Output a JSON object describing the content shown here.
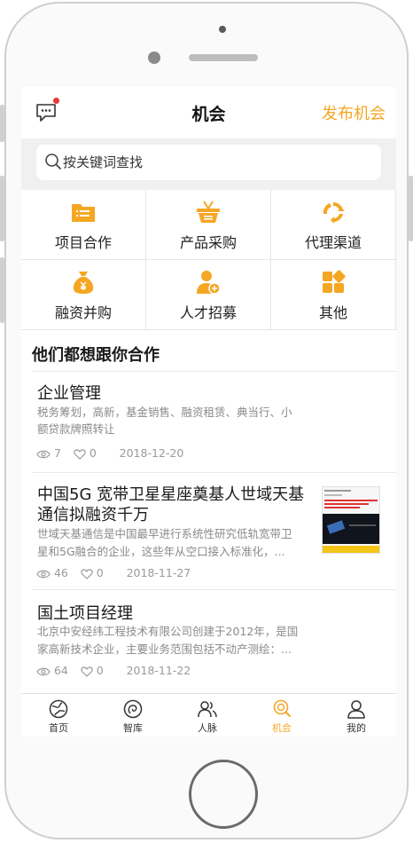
{
  "colors": {
    "accent": "#f5a623",
    "badge": "#e53935",
    "text": "#222222",
    "muted": "#8a8a8a"
  },
  "header": {
    "title": "机会",
    "publish_label": "发布机会",
    "message_icon": "chat-bubble-icon"
  },
  "search": {
    "placeholder": "按关键词查找"
  },
  "categories": [
    {
      "label": "项目合作",
      "icon": "folder-list-icon"
    },
    {
      "label": "产品采购",
      "icon": "basket-icon"
    },
    {
      "label": "代理渠道",
      "icon": "cycle-arrows-icon"
    },
    {
      "label": "融资并购",
      "icon": "money-bag-icon"
    },
    {
      "label": "人才招募",
      "icon": "add-person-icon"
    },
    {
      "label": "其他",
      "icon": "grid-icon"
    }
  ],
  "section": {
    "title": "他们都想跟你合作"
  },
  "opportunities": [
    {
      "title": "企业管理",
      "desc_lines": [
        "税务筹划，高新，基金销售、融资租赁、典当行、小",
        "额贷款牌照转让"
      ],
      "views": "7",
      "likes": "0",
      "date": "2018-12-20"
    },
    {
      "title_lines": [
        "中国5G 宽带卫星星座奠基人世域天基",
        "通信拟融资千万"
      ],
      "desc_lines": [
        "世域天基通信是中国最早进行系统性研究低轨宽带卫",
        "星和5G融合的企业，这些年从空口接入标准化，..."
      ],
      "views": "46",
      "likes": "0",
      "date": "2018-11-27",
      "has_thumbnail": true
    },
    {
      "title": "国土项目经理",
      "desc_lines": [
        "北京中安经纬工程技术有限公司创建于2012年，是国",
        "家高新技术企业，主要业务范围包括不动产测绘：..."
      ],
      "views": "64",
      "likes": "0",
      "date": "2018-11-22"
    }
  ],
  "tabs": [
    {
      "label": "首页",
      "icon": "home-globe-icon",
      "active": false
    },
    {
      "label": "智库",
      "icon": "think-tank-icon",
      "active": false
    },
    {
      "label": "人脉",
      "icon": "contacts-icon",
      "active": false
    },
    {
      "label": "机会",
      "icon": "opportunity-search-icon",
      "active": true
    },
    {
      "label": "我的",
      "icon": "profile-icon",
      "active": false
    }
  ]
}
